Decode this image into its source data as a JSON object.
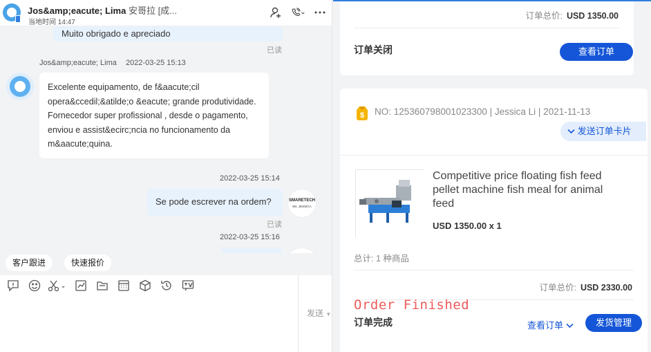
{
  "chat": {
    "header": {
      "name": "Jos&amp;eacute; Lima",
      "name_suffix": "安哥拉 [成...",
      "local_time": "当地时间 14:47"
    },
    "messages": {
      "top_bubble_text": "Muito obrigado e apreciado",
      "read_label": "已读",
      "incoming": {
        "sender": "Jos&amp;eacute; Lima",
        "time": "2022-03-25 15:13",
        "text": "Excelente equipamento, de f&aacute;cil opera&ccedil;&atilde;o &eacute; grande produtividade. Fornecedor super profissional , desde o pagamento, enviou e assist&ecirc;ncia no funcionamento da m&aacute;quina."
      },
      "outgoing_1": {
        "time": "2022-03-25 15:14",
        "text": "Se pode escrever na ordem?",
        "read": "已读"
      },
      "outgoing_2": {
        "time": "2022-03-25 15:16"
      },
      "agent_avatar": {
        "line1": "SMARETECH",
        "line2": "Ms. JESSICA"
      }
    },
    "quick_actions": [
      "客户跟进",
      "快速报价"
    ],
    "toolbar_icons": [
      "feedback-icon",
      "emoji-icon",
      "scissors-icon",
      "chart-icon",
      "folder-icon",
      "calculator-icon",
      "box-icon",
      "history-icon",
      "translate-icon"
    ],
    "send_label": "发送"
  },
  "orders": {
    "card1": {
      "total_label": "订单总价:",
      "total_value": "USD 1350.00",
      "status": "订单关闭",
      "view_button": "查看订单"
    },
    "card2": {
      "order_meta": "NO: 125360798001023300 | Jessica Li | 2021-11-13",
      "send_card": "发送订单卡片",
      "product": {
        "title": "Competitive price floating fish feed pellet machine fish meal for animal feed",
        "price": "USD 1350.00 x 1"
      },
      "count_line": "总计: 1 种商品",
      "total_label": "订单总价:",
      "total_value": "USD 2330.00",
      "watermark": "Order Finished",
      "status": "订单完成",
      "view_link": "查看订单",
      "shipping_button": "发货管理"
    }
  },
  "colors": {
    "accent": "#1556d8",
    "bubble_out": "#e8f2fd",
    "watermark": "#f05a5a"
  }
}
